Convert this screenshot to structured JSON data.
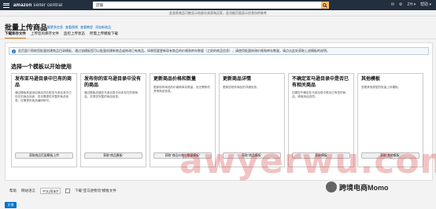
{
  "topbar": {
    "brand": "amazon",
    "brand_sub": "seller central",
    "search_value": "店铺",
    "right_items": [
      "✉",
      "⚙",
      "ZH ▾",
      "帮助 ▾"
    ]
  },
  "notice": {
    "text": "此卖家商品可能显示给部分卖家和买家，此功能页面显示信息仅供参考"
  },
  "page": {
    "title": "批量上传商品",
    "help_links": [
      "了解更多信息",
      "查看视频",
      "查看教程",
      "添加新商品"
    ]
  },
  "tabs": [
    {
      "label": "下载库存文件",
      "active": true
    },
    {
      "label": "上传您的库存文件",
      "active": false
    },
    {
      "label": "监控上传状态",
      "active": false
    },
    {
      "label": "所需上传模板下载",
      "active": false
    }
  ],
  "alert": {
    "icon": "i",
    "text": "此页面只帮助您批量创建商品目录模板，通过该模板您可以批量创建新商品或修改已有商品。如果您要更新现有商品的价格和库存数量（之前的商品信息），请使用批量修改价格和库存数量，请点击此处获取上述模板的说明。"
  },
  "section_title": "选择一个模板以开始使用",
  "cards": [
    {
      "title": "发布亚马逊目录中已有的商品",
      "desc": "通过模板批量添加商品并匹配亚马逊目录中已存在的商品页面，您无需提供完整的商品信息，仅需提供商品编码即可。",
      "button": "获取商品匹配模板上传"
    },
    {
      "title": "发布你的亚马逊目录中没有的商品",
      "desc": "通过模板创建亚马逊目录中尚未存在的新商品，并提供完整的商品信息。",
      "button": "获取\"商品模板\""
    },
    {
      "title": "更新商品价格和数量",
      "desc": "更新现有商品的价格和库存数量，但无需修改其他商品信息。",
      "button": "获取\"商品价格与数量模板\""
    },
    {
      "title": "更新商品详情",
      "desc": "更新您现有商品的详细信息。",
      "button": "获取\"商品模板\""
    },
    {
      "title": "不确定亚马逊目录中是否已有相关商品",
      "desc": "如果您不确定亚马逊目录中是否已有您的商品，请使用此选项。",
      "button": "获取模板"
    },
    {
      "title": "其他模板",
      "desc": "查看其他类型的批量上传模板。",
      "button": "获取\"其他模板\""
    }
  ],
  "bottombar": {
    "help_label": "帮助",
    "language_label": "网站语言",
    "language_value": "中文(简体)",
    "checkbox_label": "下载\"亚马逊物流\"模板文件"
  },
  "footer": {
    "button_label": "反馈"
  },
  "watermark": {
    "text": "awyerwu.com",
    "badge": "跨境电商Momo"
  },
  "colors": {
    "topbar": "#232f3e",
    "link": "#0066c0",
    "tab_accent": "#e47911",
    "primary_button": "#0073c6"
  }
}
